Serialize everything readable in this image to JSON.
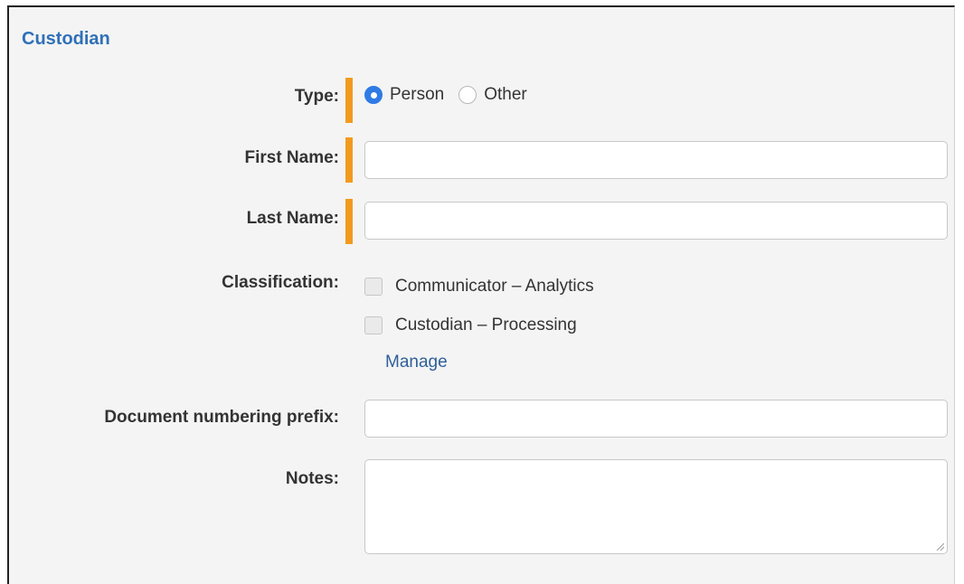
{
  "section": {
    "title": "Custodian"
  },
  "type": {
    "label": "Type:",
    "options": [
      {
        "label": "Person",
        "selected": true
      },
      {
        "label": "Other",
        "selected": false
      }
    ]
  },
  "first_name": {
    "label": "First Name:",
    "value": ""
  },
  "last_name": {
    "label": "Last Name:",
    "value": ""
  },
  "classification": {
    "label": "Classification:",
    "options": [
      {
        "label": "Communicator – Analytics",
        "checked": false
      },
      {
        "label": "Custodian – Processing",
        "checked": false
      }
    ],
    "manage_label": "Manage"
  },
  "doc_prefix": {
    "label": "Document numbering prefix:",
    "value": ""
  },
  "notes": {
    "label": "Notes:",
    "value": ""
  },
  "colors": {
    "title": "#2f70b8",
    "required_bar": "#f29a1f",
    "radio_selected": "#2f7be5",
    "link": "#2f5f99"
  }
}
